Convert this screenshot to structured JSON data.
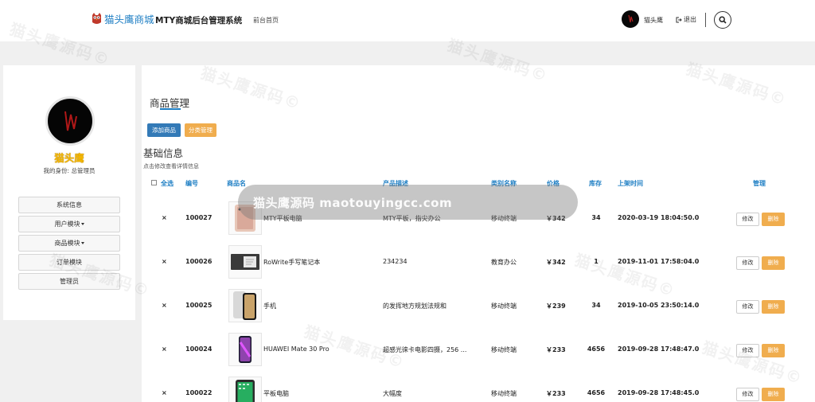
{
  "navbar": {
    "logo_text": "猫头鹰商城",
    "system_title": "MTY商城后台管理系统",
    "home_link": "前台首页",
    "username": "猫头鹰",
    "logout_label": "退出"
  },
  "sidebar": {
    "name": "猫头鹰",
    "role_text": "我的身份: 总管理员",
    "menu": [
      {
        "label": "系统信息"
      },
      {
        "label": "用户模块"
      },
      {
        "label": "商品模块"
      },
      {
        "label": "订单模块"
      },
      {
        "label": "管理员"
      }
    ]
  },
  "main": {
    "title": "商品管理",
    "add_button": "添加商品",
    "category_button": "分类管理",
    "section_title": "基础信息",
    "section_hint": "点击修改查看详情信息",
    "columns": {
      "select_all": "全选",
      "id": "编号",
      "name": "商品名",
      "desc": "产品描述",
      "category": "类别名称",
      "price": "价格",
      "stock": "库存",
      "time": "上架时间",
      "manage": "管理"
    },
    "edit_label": "修改",
    "delete_label": "删除",
    "rows": [
      {
        "mark": "×",
        "id": "100027",
        "name": "MTY平板电脑",
        "desc": "MTY平板，指尖办公",
        "category": "移动终端",
        "price": "￥342",
        "stock": "34",
        "time": "2020-03-19 18:04:50.0",
        "thumb": "tablet-gold"
      },
      {
        "mark": "×",
        "id": "100026",
        "name": "RoWrite手写笔记本",
        "desc": "234234",
        "category": "教育办公",
        "price": "￥342",
        "stock": "1",
        "time": "2019-11-01 17:58:04.0",
        "thumb": "notebook"
      },
      {
        "mark": "×",
        "id": "100025",
        "name": "手机",
        "desc": "的发挥地方规划法规和",
        "category": "移动终端",
        "price": "￥239",
        "stock": "34",
        "time": "2019-10-05 23:50:14.0",
        "thumb": "iphone"
      },
      {
        "mark": "×",
        "id": "100024",
        "name": "HUAWEI Mate 30 Pro",
        "desc": "超感光徕卡电影四摄，256 ...",
        "category": "移动终端",
        "price": "￥233",
        "stock": "4656",
        "time": "2019-09-28 17:48:47.0",
        "thumb": "huawei"
      },
      {
        "mark": "×",
        "id": "100022",
        "name": "平板电脑",
        "desc": "大幅度",
        "category": "移动终端",
        "price": "￥233",
        "stock": "4656",
        "time": "2019-09-28 17:48:45.0",
        "thumb": "tablet-dark"
      }
    ]
  },
  "watermark": {
    "banner": "猫头鹰源码 maotouyingcc.com",
    "tile": "猫头鹰源码©"
  },
  "colors": {
    "primary": "#337ab7",
    "warning": "#f0ad4e",
    "header_text": "#1f7fc4",
    "name_gold": "#f3b600"
  }
}
